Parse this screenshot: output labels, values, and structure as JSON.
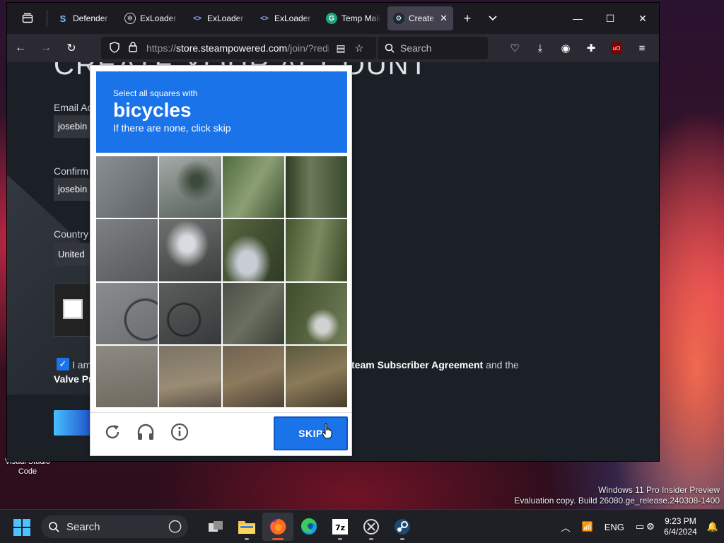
{
  "desktop": {
    "icon_label": "Visual Studio Code",
    "watermark_line1": "Windows 11 Pro Insider Preview",
    "watermark_line2": "Evaluation copy. Build 26080.ge_release.240308-1400"
  },
  "browser": {
    "tabs": [
      {
        "title": "Defender",
        "active": false
      },
      {
        "title": "ExLoader",
        "active": false
      },
      {
        "title": "ExLoader",
        "active": false
      },
      {
        "title": "ExLoader",
        "active": false
      },
      {
        "title": "Temp Mail",
        "active": false
      },
      {
        "title": "Create",
        "active": true
      }
    ],
    "url_host": "store.steampowered.com",
    "url_prefix": "https://",
    "url_suffix": "/join/?redir",
    "search_placeholder": "Search"
  },
  "page": {
    "heading": "CREATE YOUR ACCOUNT",
    "email_label": "Email Ac",
    "email_value": "josebin",
    "confirm_label": "Confirm",
    "confirm_value": "josebin",
    "country_label": "Country",
    "country_value": "United",
    "agree_prefix": "I am",
    "agree_link": "team Subscriber Agreement",
    "agree_suffix": "and the",
    "agree_line2": "Valve Pr"
  },
  "recaptcha": {
    "instruction": "Select all squares with",
    "target": "bicycles",
    "hint": "If there are none, click skip",
    "skip_label": "SKIP"
  },
  "taskbar": {
    "search_placeholder": "Search",
    "language": "ENG",
    "time": "9:23 PM",
    "date": "6/4/2024"
  }
}
